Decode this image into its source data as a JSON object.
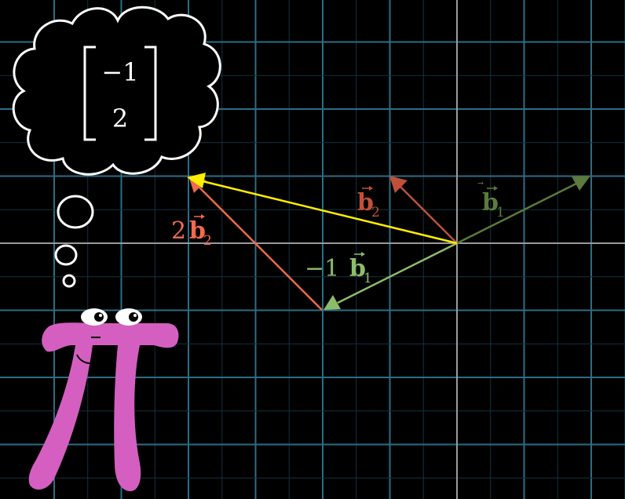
{
  "thought": {
    "matrix_top": "−1",
    "matrix_bottom": "2"
  },
  "vectors": {
    "b1": {
      "sym": "b",
      "sub": "1",
      "color": "#5c7a3c"
    },
    "b2": {
      "sym": "b",
      "sub": "2",
      "color": "#c0503a"
    },
    "neg_b1": {
      "coef": "−1",
      "sym": "b",
      "sub": "1",
      "color": "#8bbd6a"
    },
    "two_b2": {
      "coef": "2",
      "sym": "b",
      "sub": "2",
      "color": "#f06a4e"
    },
    "sum_color": "#ffee00"
  },
  "colors": {
    "background": "#000000",
    "grid_major": "#2c6d86",
    "grid_minor": "#12323e",
    "axis": "#9a9a9a",
    "pi": "#d45fc0"
  }
}
